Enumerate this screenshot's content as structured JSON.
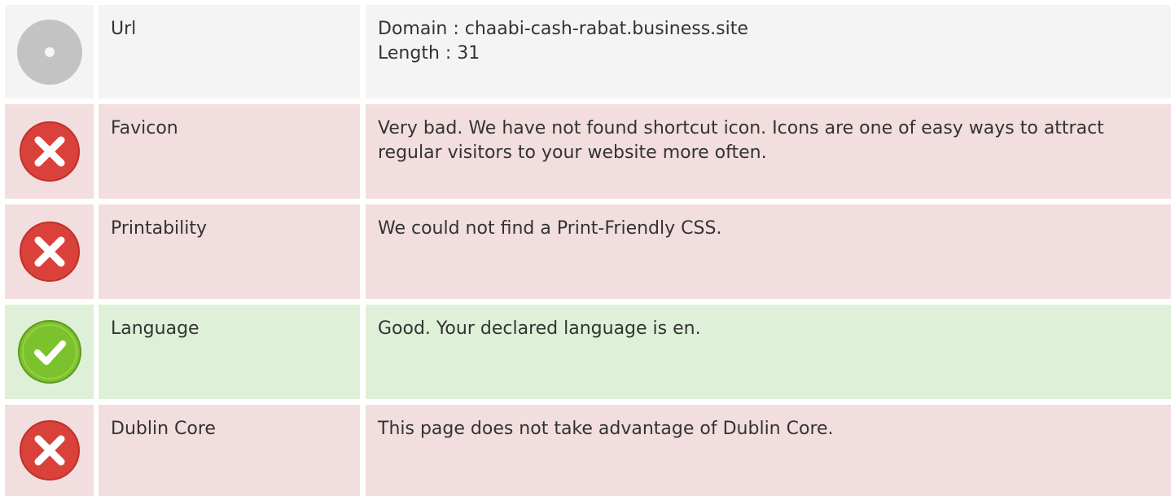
{
  "rows": [
    {
      "status": "neutral",
      "icon": "neutral-circle-icon",
      "name": "Url",
      "lines": [
        "Domain : chaabi-cash-rabat.business.site",
        "Length : 31"
      ]
    },
    {
      "status": "bad",
      "icon": "error-x-icon",
      "name": "Favicon",
      "lines": [
        "Very bad. We have not found shortcut icon. Icons are one of easy ways to attract regular visitors to your website more often."
      ]
    },
    {
      "status": "bad",
      "icon": "error-x-icon",
      "name": "Printability",
      "lines": [
        "We could not find a Print-Friendly CSS."
      ]
    },
    {
      "status": "good",
      "icon": "success-check-icon",
      "name": "Language",
      "lines": [
        "Good. Your declared language is en."
      ]
    },
    {
      "status": "bad",
      "icon": "error-x-icon",
      "name": "Dublin Core",
      "lines": [
        "This page does not take advantage of Dublin Core."
      ]
    }
  ],
  "colors": {
    "neutral_bg": "#f4f4f4",
    "bad_bg": "#f2dede",
    "good_bg": "#dff0d8",
    "bad_icon": "#d9413a",
    "good_icon": "#7cc22d",
    "neutral_icon": "#c3c3c3"
  }
}
